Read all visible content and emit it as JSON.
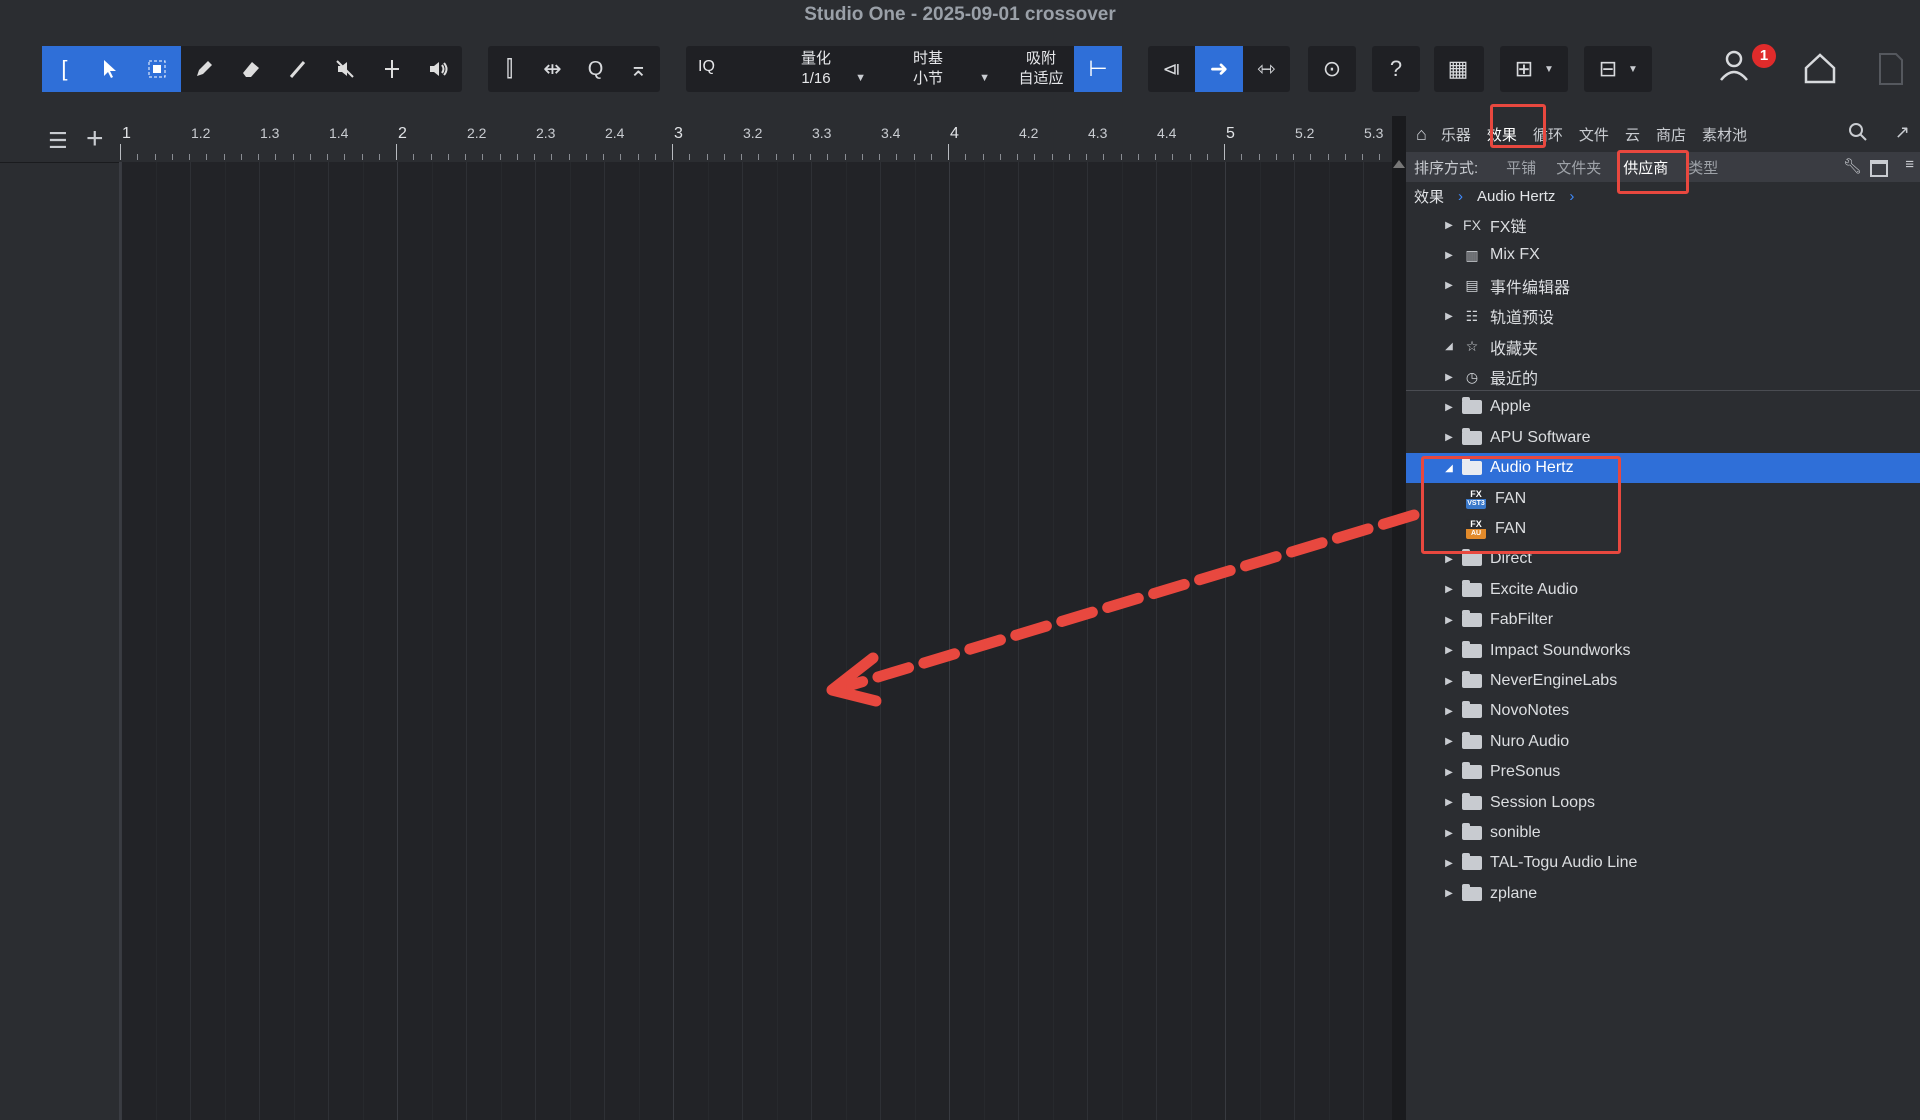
{
  "window": {
    "title": "Studio One - 2025-09-01 crossover"
  },
  "toolbar": {
    "quantize": {
      "label": "量化",
      "value": "1/16"
    },
    "timebase": {
      "label": "时基",
      "value": "小节"
    },
    "snap": {
      "label": "吸附",
      "value": "自适应"
    },
    "iq_label": "IQ",
    "notification_count": "1",
    "help_label": "?"
  },
  "ruler": {
    "labels": [
      "1",
      "1.2",
      "1.3",
      "1.4",
      "2",
      "2.2",
      "2.3",
      "2.4",
      "3",
      "3.2",
      "3.3",
      "3.4",
      "4",
      "4.2",
      "4.3",
      "4.4",
      "5",
      "5.2",
      "5.3"
    ]
  },
  "browser": {
    "tabs": [
      "乐器",
      "效果",
      "循环",
      "文件",
      "云",
      "商店",
      "素材池"
    ],
    "active_tab": "效果",
    "sort": {
      "label": "排序方式:",
      "options": [
        "平铺",
        "文件夹",
        "供应商",
        "类型"
      ],
      "active": "供应商"
    },
    "breadcrumb": [
      "效果",
      "Audio Hertz"
    ],
    "top_items": [
      {
        "label": "FX链",
        "icon": "fx-chain-icon"
      },
      {
        "label": "Mix FX",
        "icon": "mix-fx-icon"
      },
      {
        "label": "事件编辑器",
        "icon": "event-editor-icon"
      },
      {
        "label": "轨道预设",
        "icon": "track-preset-icon"
      },
      {
        "label": "收藏夹",
        "icon": "star-icon"
      },
      {
        "label": "最近的",
        "icon": "clock-icon"
      }
    ],
    "vendors": [
      "Apple",
      "APU Software",
      "Audio Hertz",
      "Direct",
      "Excite Audio",
      "FabFilter",
      "Impact Soundworks",
      "NeverEngineLabs",
      "NovoNotes",
      "Nuro Audio",
      "PreSonus",
      "Session Loops",
      "sonible",
      "TAL-Togu Audio Line",
      "zplane"
    ],
    "expanded_vendor": "Audio Hertz",
    "plugins": [
      {
        "label": "FAN",
        "badge_top": "FX",
        "badge_bottom": "VST3",
        "color": "#3a78c9"
      },
      {
        "label": "FAN",
        "badge_top": "FX",
        "badge_bottom": "AU",
        "color": "#e28a2b"
      }
    ]
  },
  "annotation_color": "#e8483f"
}
